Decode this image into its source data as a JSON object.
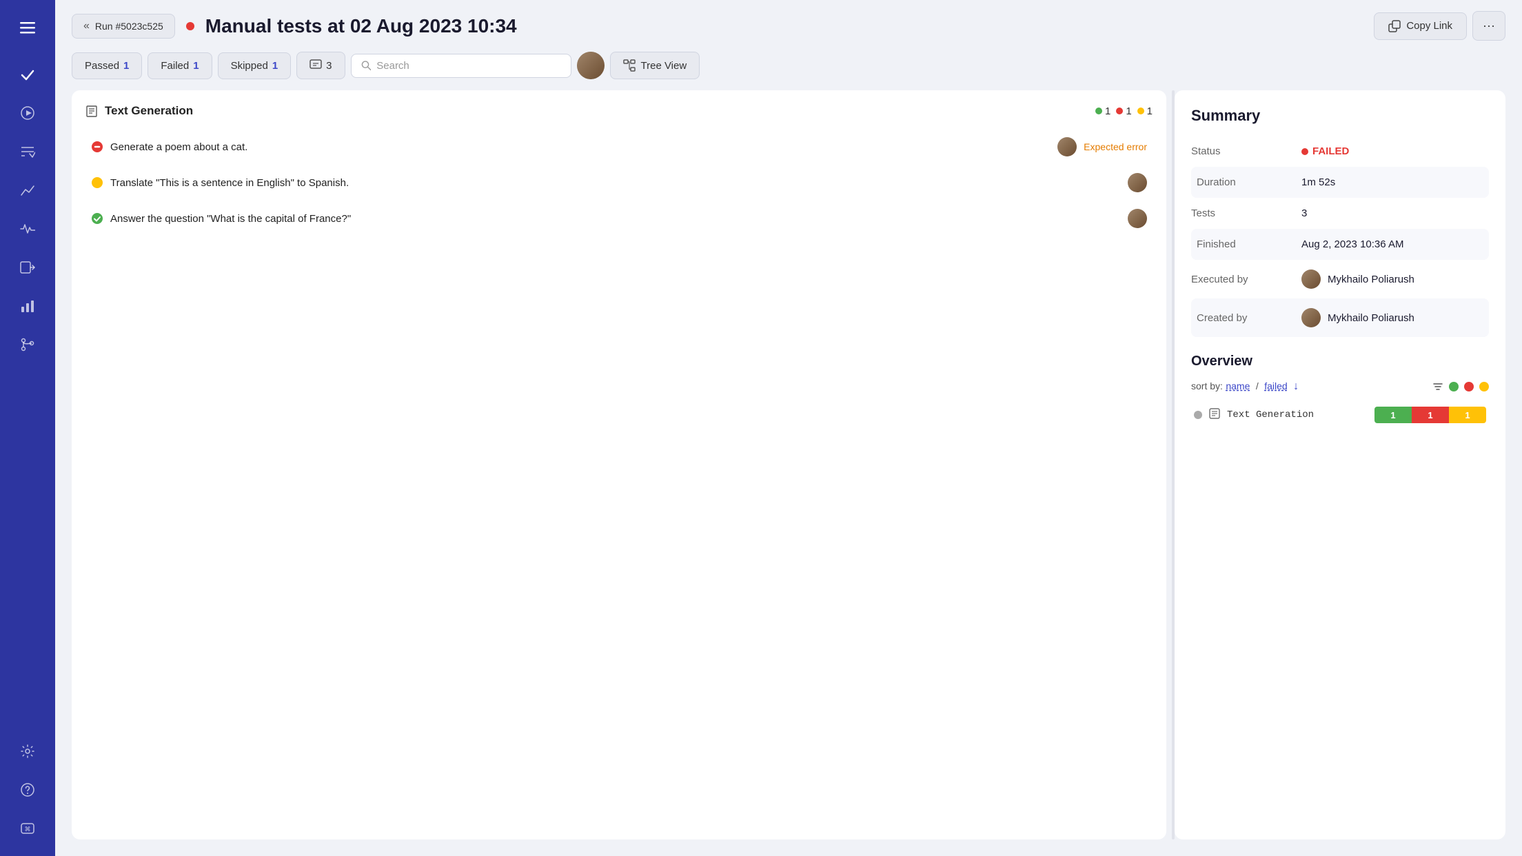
{
  "sidebar": {
    "items": [
      {
        "name": "menu",
        "icon": "☰",
        "label": "Menu"
      },
      {
        "name": "check",
        "icon": "✓",
        "label": "Check"
      },
      {
        "name": "play",
        "icon": "▶",
        "label": "Play"
      },
      {
        "name": "checklist",
        "icon": "≡✓",
        "label": "Checklist"
      },
      {
        "name": "trend",
        "icon": "↗",
        "label": "Trend"
      },
      {
        "name": "pulse",
        "icon": "∿",
        "label": "Pulse"
      },
      {
        "name": "import",
        "icon": "→□",
        "label": "Import"
      },
      {
        "name": "chart",
        "icon": "▦",
        "label": "Chart"
      },
      {
        "name": "branch",
        "icon": "⑂",
        "label": "Branch"
      },
      {
        "name": "settings",
        "icon": "⚙",
        "label": "Settings"
      },
      {
        "name": "help",
        "icon": "?",
        "label": "Help"
      },
      {
        "name": "shortcut",
        "icon": "⌘",
        "label": "Shortcut"
      }
    ]
  },
  "header": {
    "run_badge": "Run #5023c525",
    "title": "Manual tests at 02 Aug 2023 10:34",
    "copy_link_label": "Copy Link",
    "more_label": "···"
  },
  "toolbar": {
    "passed_label": "Passed",
    "passed_count": "1",
    "failed_label": "Failed",
    "failed_count": "1",
    "skipped_label": "Skipped",
    "skipped_count": "1",
    "chat_count": "3",
    "search_placeholder": "Search",
    "tree_view_label": "Tree View"
  },
  "suite": {
    "name": "Text Generation",
    "count_green": "1",
    "count_red": "1",
    "count_yellow": "1",
    "tests": [
      {
        "id": 1,
        "status": "failed",
        "name": "Generate a poem about a cat.",
        "tag": "Expected error"
      },
      {
        "id": 2,
        "status": "pending",
        "name": "Translate \"This is a sentence in English\" to Spanish.",
        "tag": ""
      },
      {
        "id": 3,
        "status": "passed",
        "name": "Answer the question \"What is the capital of France?\"",
        "tag": ""
      }
    ]
  },
  "summary": {
    "title": "Summary",
    "status_label": "Status",
    "status_value": "FAILED",
    "duration_label": "Duration",
    "duration_value": "1m 52s",
    "tests_label": "Tests",
    "tests_value": "3",
    "finished_label": "Finished",
    "finished_value": "Aug 2, 2023 10:36 AM",
    "executed_by_label": "Executed by",
    "executed_by_value": "Mykhailo Poliarush",
    "created_by_label": "Created by",
    "created_by_value": "Mykhailo Poliarush"
  },
  "overview": {
    "title": "Overview",
    "sort_label": "sort by:",
    "sort_name": "name",
    "sort_separator": "/",
    "sort_failed": "failed",
    "items": [
      {
        "name": "Text Generation",
        "count_green": "1",
        "count_red": "1",
        "count_yellow": "1"
      }
    ]
  }
}
